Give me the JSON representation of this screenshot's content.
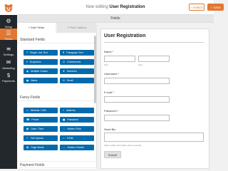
{
  "header": {
    "title_prefix": "Now editing",
    "title_name": "User Registration",
    "embed_label": "EMBED",
    "save_label": "SAVE"
  },
  "sidebar": {
    "items": [
      {
        "label": "Setup",
        "icon": "gear-icon"
      },
      {
        "label": "Fields",
        "icon": "list-icon"
      },
      {
        "label": "Settings",
        "icon": "sliders-icon"
      },
      {
        "label": "Marketing",
        "icon": "megaphone-icon"
      },
      {
        "label": "Payments",
        "icon": "dollar-icon"
      }
    ],
    "active": "Fields",
    "accent": "#e27730"
  },
  "fields_bar": "Fields",
  "tabs": {
    "add": "Add Fields",
    "options": "Field Options"
  },
  "standard_fields": {
    "title": "Standard Fields",
    "buttons": [
      "Single Line Text",
      "Paragraph Text",
      "Dropdown",
      "Checkboxes",
      "Multiple Choice",
      "Numbers",
      "Name",
      "Email"
    ]
  },
  "fancy_fields": {
    "title": "Fancy Fields",
    "buttons": [
      "Website / URL",
      "Address",
      "Phone",
      "Password",
      "Date / Time",
      "Hidden Field",
      "File Upload",
      "HTML",
      "Page Break",
      "Section Divider"
    ]
  },
  "payment_fields": {
    "title": "Payment Fields"
  },
  "form": {
    "title": "User Registration",
    "name_label": "Name",
    "required_mark": "*",
    "first_label": "First",
    "last_label": "Last",
    "username_label": "Username",
    "email_label": "E-mail",
    "password_label": "Password",
    "bio_label": "Short Bio",
    "bio_help": "Share a little information about yourself.",
    "submit_label": "Submit"
  },
  "colors": {
    "button_blue": "#036aab",
    "brand_orange": "#e27730"
  }
}
